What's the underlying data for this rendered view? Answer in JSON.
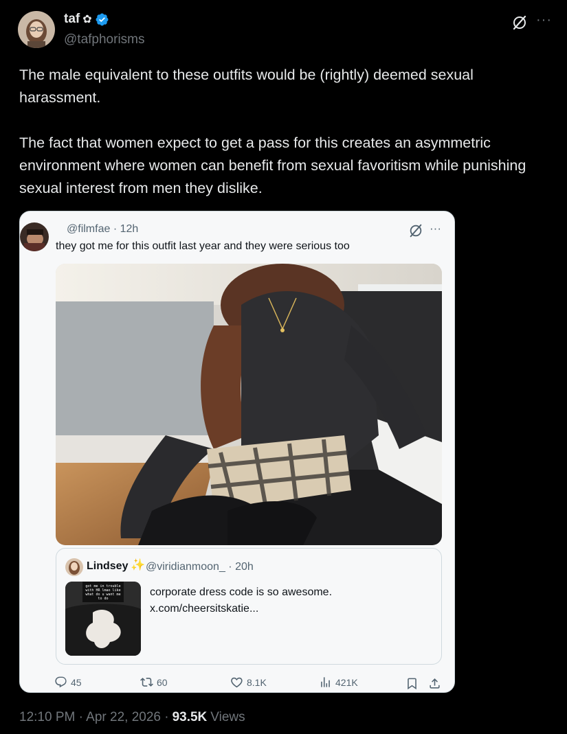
{
  "author": {
    "name": "taf",
    "flower": "✿",
    "handle": "@tafphorisms"
  },
  "menu": {
    "more": "···"
  },
  "body": "The male equivalent to these outfits would be (rightly) deemed sexual harassment.\n\nThe fact that women expect to get a pass for this creates an asymmetric environment where women can benefit from sexual favoritism while punishing sexual interest from men they dislike.",
  "quote": {
    "meta": "@filmfae · 12h",
    "text": "they got me for this outfit last year and they were serious too",
    "inner": {
      "name": "Lindsey",
      "sparkle": "✨",
      "handle": "@viridianmoon_ · 20h",
      "text": "corporate dress code is so awesome.\nx.com/cheersitskatie...",
      "thumb_caption": "got me in trouble with HR lmao like what do u want me to do"
    },
    "actions": {
      "replies": "45",
      "reposts": "60",
      "likes": "8.1K",
      "views": "421K"
    }
  },
  "footer": {
    "time": "12:10 PM · Apr 22, 2026 ·",
    "views_count": "93.5K",
    "views_label": "Views"
  },
  "colors": {
    "background": "#000000",
    "text_primary": "#e7e9ea",
    "text_secondary": "#71767b",
    "verified": "#1d9bf0",
    "card_bg": "#f7f8f9"
  }
}
